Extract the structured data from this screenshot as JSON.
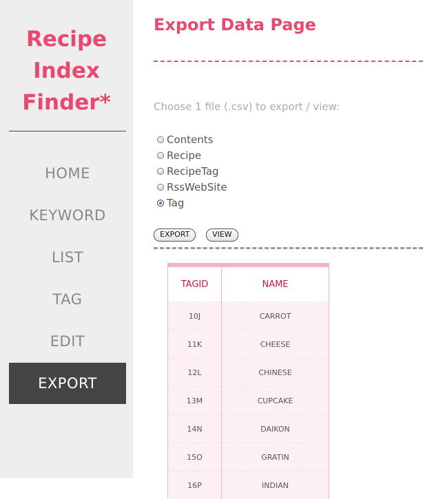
{
  "sidebar": {
    "logo_lines": [
      "Recipe",
      "Index",
      "Finder*"
    ],
    "nav": [
      {
        "label": "HOME"
      },
      {
        "label": "KEYWORD"
      },
      {
        "label": "LIST"
      },
      {
        "label": "TAG"
      },
      {
        "label": "EDIT"
      },
      {
        "label": "EXPORT",
        "active": true
      }
    ]
  },
  "main": {
    "title": "Export Data Page",
    "instruction": "Choose 1 file (.csv) to export / view:",
    "options": [
      {
        "label": "Contents",
        "checked": false
      },
      {
        "label": "Recipe",
        "checked": false
      },
      {
        "label": "RecipeTag",
        "checked": false
      },
      {
        "label": "RssWebSite",
        "checked": false
      },
      {
        "label": "Tag",
        "checked": true
      }
    ],
    "buttons": {
      "export": "EXPORT",
      "view": "VIEW"
    },
    "table": {
      "headers": [
        "TAGID",
        "NAME"
      ],
      "rows": [
        [
          "10J",
          "CARROT"
        ],
        [
          "11K",
          "CHEESE"
        ],
        [
          "12L",
          "CHINESE"
        ],
        [
          "13M",
          "CUPCAKE"
        ],
        [
          "14N",
          "DAIKON"
        ],
        [
          "15O",
          "GRATIN"
        ],
        [
          "16P",
          "INDIAN"
        ]
      ]
    }
  },
  "colors": {
    "accent": "#e8496f",
    "sidebar_bg": "#eeeeee",
    "active_bg": "#444444",
    "table_border": "#f2b3c4",
    "table_header_text": "#c0174e"
  }
}
